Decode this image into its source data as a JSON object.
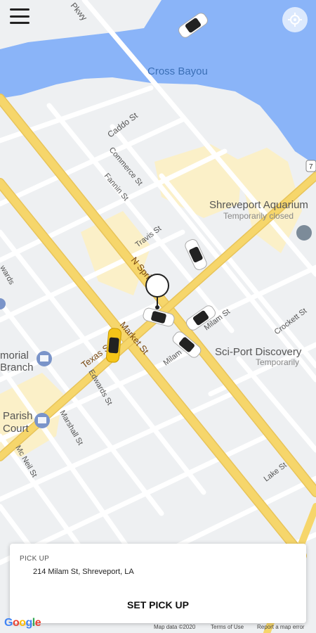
{
  "header": {
    "menu_icon": "hamburger-menu-icon",
    "locate_icon": "my-location-icon"
  },
  "map": {
    "labels": {
      "water": "Cross Bayou",
      "street_parkway": "Pkwy",
      "caddo": "Caddo St",
      "commerce": "Commerce St",
      "fannin": "Fannin St",
      "travis": "Travis St",
      "n_spring": "N Spring St",
      "milam_right": "Milam St",
      "milam_lower": "Milam",
      "texas": "Texas St",
      "market": "Market St",
      "edwards": "Edwards St",
      "crockett": "Crockett St",
      "marshall": "Marshall St",
      "mcneil": "Mc Neil St",
      "lake": "Lake St",
      "aquarium": "Shreveport Aquarium",
      "aquarium_status": "Temporarily closed",
      "sciport": "Sci-Port Discovery",
      "sciport_status": "Temporarily",
      "memorial": "morial",
      "memorial2": "Branch",
      "parish": "Parish",
      "parish2": "Court",
      "wards": "wards",
      "highway_shield": "7"
    },
    "pin_icon": "pickup-pin-icon",
    "car_icon": "car-icon"
  },
  "pickup_card": {
    "heading": "PICK UP",
    "address": "214 Milam St, Shreveport, LA",
    "button": "SET PICK UP"
  },
  "footer": {
    "google": [
      "G",
      "o",
      "o",
      "g",
      "l",
      "e"
    ],
    "map_data": "Map data ©2020",
    "terms": "Terms of Use",
    "report": "Report a map error"
  },
  "colors": {
    "water": "#8ab4f8",
    "highway": "#f6d66b",
    "road": "#ffffff",
    "land": "#eef0f2",
    "accent_car": "#f5c518"
  }
}
